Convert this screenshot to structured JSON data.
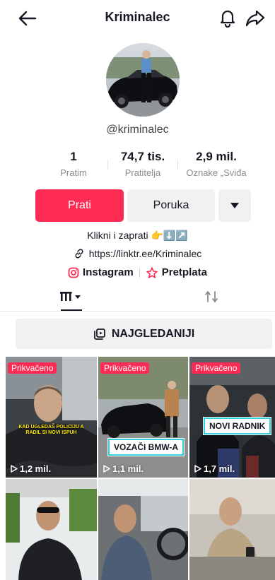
{
  "header": {
    "title": "Kriminalec"
  },
  "profile": {
    "username": "@kriminalec",
    "stats": [
      {
        "value": "1",
        "label": "Pratim"
      },
      {
        "value": "74,7 tis.",
        "label": "Pratitelja"
      },
      {
        "value": "2,9 mil.",
        "label": "Oznake „Sviđa"
      }
    ]
  },
  "actions": {
    "follow_label": "Prati",
    "message_label": "Poruka"
  },
  "bio": {
    "text": "Klikni i zaprati 👉⬇️↗️",
    "link": "https://linktr.ee/Kriminalec",
    "instagram_label": "Instagram",
    "subscription_label": "Pretplata"
  },
  "most_viewed_label": "NAJGLEDANIJI",
  "videos": [
    {
      "pinned": "Prikvačeno",
      "views": "1,2 mil.",
      "caption": "KAD UGLEDAŠ POLICIJU A RADIL SI NOVI ISPUH"
    },
    {
      "pinned": "Prikvačeno",
      "views": "1,1 mil.",
      "caption": "VOZAČI BMW-A"
    },
    {
      "pinned": "Prikvačeno",
      "views": "1,7 mil.",
      "caption": "NOVI RADNIK"
    },
    {
      "pinned": "",
      "views": "",
      "caption": ""
    },
    {
      "pinned": "",
      "views": "",
      "caption": ""
    },
    {
      "pinned": "",
      "views": "",
      "caption": ""
    }
  ],
  "colors": {
    "accent": "#fe2c55",
    "caption_border": "#2fd0d8"
  }
}
